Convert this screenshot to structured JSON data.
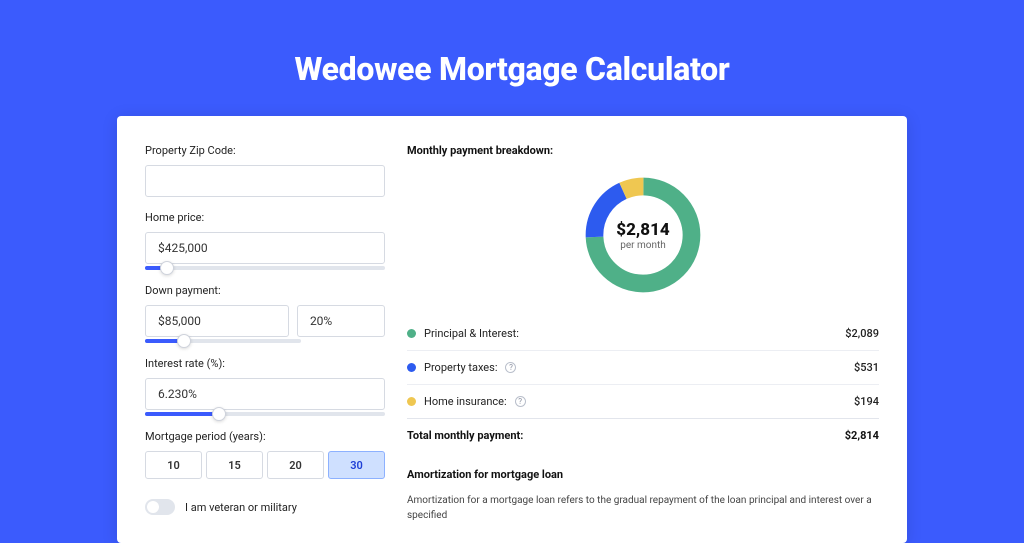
{
  "page": {
    "title": "Wedowee Mortgage Calculator"
  },
  "form": {
    "zip_label": "Property Zip Code:",
    "zip_value": "",
    "home_price_label": "Home price:",
    "home_price_value": "$425,000",
    "home_price_slider_pct": 9,
    "down_payment_label": "Down payment:",
    "down_payment_value": "$85,000",
    "down_payment_pct_value": "20%",
    "down_payment_slider_pct": 25,
    "interest_label": "Interest rate (%):",
    "interest_value": "6.230%",
    "interest_slider_pct": 31,
    "period_label": "Mortgage period (years):",
    "periods": [
      "10",
      "15",
      "20",
      "30"
    ],
    "period_selected": "30",
    "veteran_label": "I am veteran or military"
  },
  "breakdown": {
    "title": "Monthly payment breakdown:",
    "center_amount": "$2,814",
    "center_per": "per month",
    "items": [
      {
        "label": "Principal & Interest:",
        "value": "$2,089",
        "color": "#4fb088",
        "help": false
      },
      {
        "label": "Property taxes:",
        "value": "$531",
        "color": "#2d5bef",
        "help": true
      },
      {
        "label": "Home insurance:",
        "value": "$194",
        "color": "#efc751",
        "help": true
      }
    ],
    "total_label": "Total monthly payment:",
    "total_value": "$2,814"
  },
  "chart_data": {
    "type": "pie",
    "title": "Monthly payment breakdown",
    "series": [
      {
        "name": "Principal & Interest",
        "value": 2089,
        "color": "#4fb088"
      },
      {
        "name": "Property taxes",
        "value": 531,
        "color": "#2d5bef"
      },
      {
        "name": "Home insurance",
        "value": 194,
        "color": "#efc751"
      }
    ],
    "total": 2814,
    "unit": "USD / month"
  },
  "amortization": {
    "title": "Amortization for mortgage loan",
    "text": "Amortization for a mortgage loan refers to the gradual repayment of the loan principal and interest over a specified"
  }
}
